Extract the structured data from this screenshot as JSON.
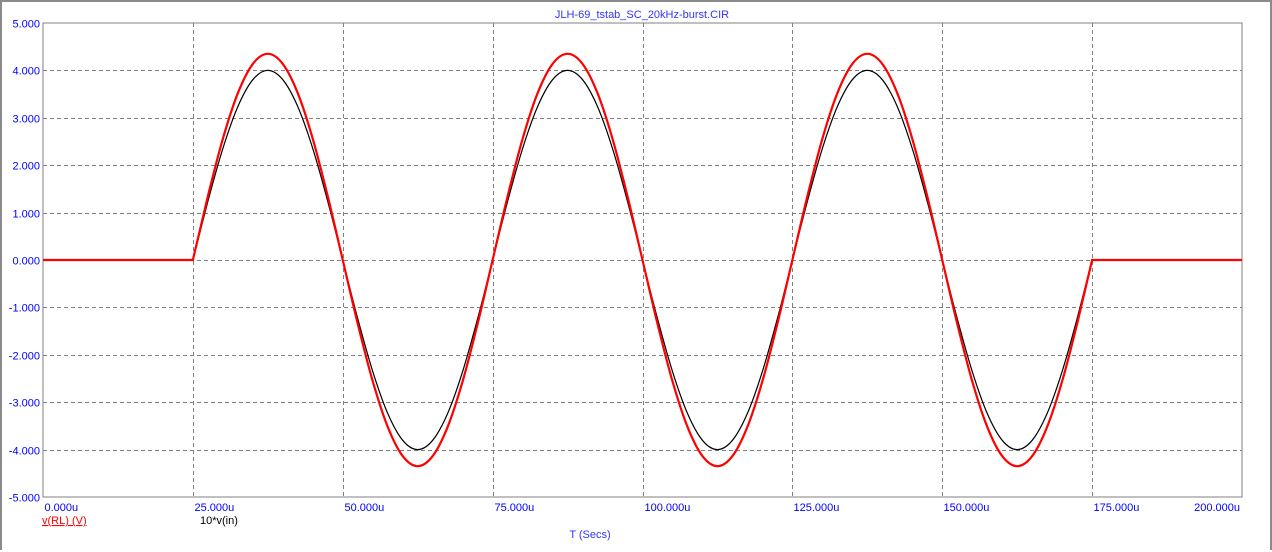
{
  "chart_data": {
    "type": "line",
    "title": "JLH-69_tstab_SC_20kHz-burst.CIR",
    "xlabel": "T (Secs)",
    "ylabel": "",
    "xlim": [
      0,
      200
    ],
    "ylim": [
      -5,
      5
    ],
    "grid": true,
    "x_ticks": [
      "0.000u",
      "25.000u",
      "50.000u",
      "75.000u",
      "100.000u",
      "125.000u",
      "150.000u",
      "175.000u",
      "200.000u"
    ],
    "y_ticks": [
      "5.000",
      "4.000",
      "3.000",
      "2.000",
      "1.000",
      "0.000",
      "-1.000",
      "-2.000",
      "-3.000",
      "-4.000",
      "-5.000"
    ],
    "x_unit": "u",
    "x": [
      0,
      2.5,
      5,
      7.5,
      10,
      12.5,
      15,
      17.5,
      20,
      22.5,
      25,
      27.5,
      30,
      32.5,
      35,
      37.5,
      40,
      42.5,
      45,
      47.5,
      50,
      52.5,
      55,
      57.5,
      60,
      62.5,
      65,
      67.5,
      70,
      72.5,
      75,
      77.5,
      80,
      82.5,
      85,
      87.5,
      90,
      92.5,
      95,
      97.5,
      100,
      102.5,
      105,
      107.5,
      110,
      112.5,
      115,
      117.5,
      120,
      122.5,
      125,
      127.5,
      130,
      132.5,
      135,
      137.5,
      140,
      142.5,
      145,
      147.5,
      150,
      152.5,
      155,
      157.5,
      160,
      162.5,
      165,
      167.5,
      170,
      172.5,
      175,
      177.5,
      180,
      182.5,
      185,
      187.5,
      190,
      192.5,
      195,
      197.5,
      200
    ],
    "series": [
      {
        "name": "v(RL) (V)",
        "color": "#ff0000",
        "values": [
          0,
          0,
          0,
          0,
          0,
          0,
          0,
          0,
          0,
          0,
          0,
          1.344,
          2.557,
          3.519,
          4.137,
          4.35,
          4.137,
          3.519,
          2.557,
          1.344,
          0,
          -1.344,
          -2.557,
          -3.519,
          -4.137,
          -4.35,
          -4.137,
          -3.519,
          -2.557,
          -1.344,
          0,
          1.344,
          2.557,
          3.519,
          4.137,
          4.35,
          4.137,
          3.519,
          2.557,
          1.344,
          0,
          -1.344,
          -2.557,
          -3.519,
          -4.137,
          -4.35,
          -4.137,
          -3.519,
          -2.557,
          -1.344,
          0,
          1.344,
          2.557,
          3.519,
          4.137,
          4.35,
          4.137,
          3.519,
          2.557,
          1.344,
          0,
          -1.344,
          -2.557,
          -3.519,
          -4.137,
          -4.35,
          -4.137,
          -3.519,
          -2.557,
          -1.344,
          0,
          0,
          0,
          0,
          0,
          0,
          0,
          0,
          0,
          0,
          0
        ]
      },
      {
        "name": "10*v(in)",
        "color": "#000000",
        "values": [
          0,
          0,
          0,
          0,
          0,
          0,
          0,
          0,
          0,
          0,
          0,
          1.236,
          2.351,
          3.236,
          3.804,
          4.0,
          3.804,
          3.236,
          2.351,
          1.236,
          0,
          -1.236,
          -2.351,
          -3.236,
          -3.804,
          -4.0,
          -3.804,
          -3.236,
          -2.351,
          -1.236,
          0,
          1.236,
          2.351,
          3.236,
          3.804,
          4.0,
          3.804,
          3.236,
          2.351,
          1.236,
          0,
          -1.236,
          -2.351,
          -3.236,
          -3.804,
          -4.0,
          -3.804,
          -3.236,
          -2.351,
          -1.236,
          0,
          1.236,
          2.351,
          3.236,
          3.804,
          4.0,
          3.804,
          3.236,
          2.351,
          1.236,
          0,
          -1.236,
          -2.351,
          -3.236,
          -3.804,
          -4.0,
          -3.804,
          -3.236,
          -2.351,
          -1.236,
          0,
          0,
          0,
          0,
          0,
          0,
          0,
          0,
          0,
          0,
          0
        ]
      }
    ],
    "legend_placement": "bottom-left",
    "colors": {
      "axis_text": "#0000ff",
      "grid": "#808080"
    }
  }
}
